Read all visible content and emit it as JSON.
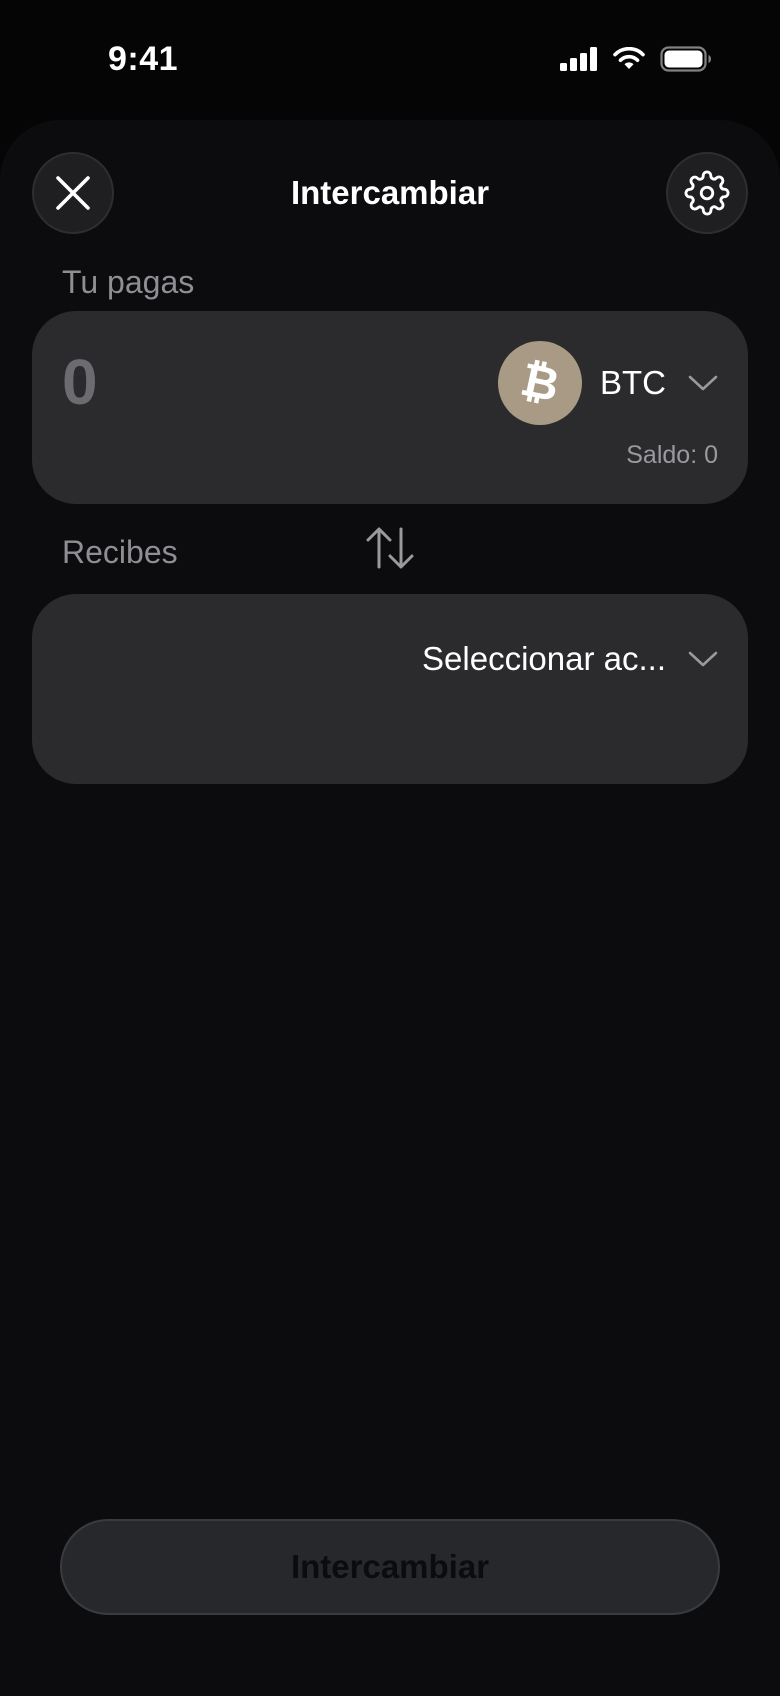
{
  "status_bar": {
    "time": "9:41"
  },
  "header": {
    "title": "Intercambiar",
    "close_icon": "close-icon",
    "settings_icon": "gear-icon"
  },
  "pay": {
    "label": "Tu pagas",
    "amount_placeholder": "0",
    "token_symbol": "BTC",
    "balance_label": "Saldo:",
    "balance_value": "0"
  },
  "receive": {
    "label": "Recibes",
    "select_label": "Seleccionar ac..."
  },
  "submit": {
    "label": "Intercambiar"
  },
  "colors": {
    "background": "#050506",
    "sheet": "#0c0c0e",
    "card": "#2b2b2e",
    "muted_text": "#8e8e93",
    "btc_logo": "#a89a84",
    "button_disabled": "#27282c"
  }
}
